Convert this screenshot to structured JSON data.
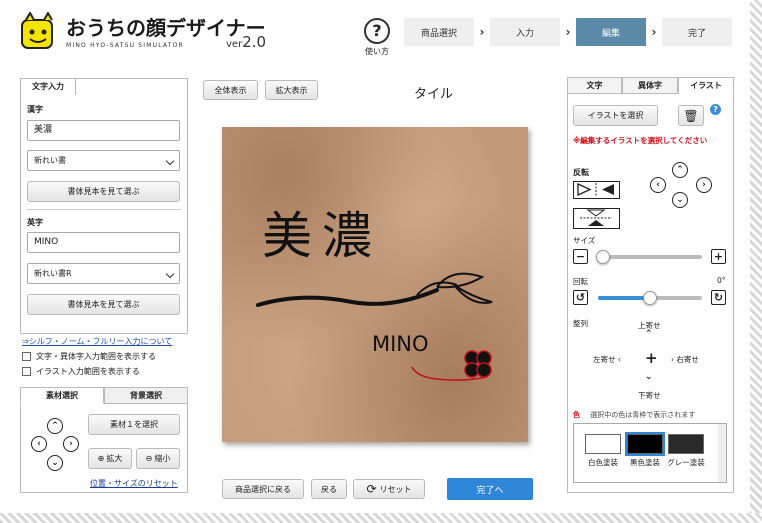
{
  "header": {
    "app_title": "おうちの顔デザイナー",
    "app_subtitle": "MINO HYO-SATSU SIMULATOR",
    "version_prefix": "ver",
    "version_number": "2.0",
    "help_label": "使い方",
    "steps": [
      {
        "label": "商品選択",
        "active": false
      },
      {
        "label": "入力",
        "active": false
      },
      {
        "label": "編集",
        "active": true
      },
      {
        "label": "完了",
        "active": false
      }
    ]
  },
  "text_input_panel": {
    "tab_label": "文字入力",
    "kanji_label": "漢字",
    "kanji_value": "美濃",
    "kanji_font": "新れい書",
    "kanji_sample_button": "書体見本を見て選ぶ",
    "english_label": "英字",
    "english_value": "MINO",
    "english_font": "新れい書R",
    "english_sample_button": "書体見本を見て選ぶ",
    "link_text": "⇒シルフ・ノーム・フルリー入力について",
    "checkbox_text_range": "文字・異体字入力範囲を表示する",
    "checkbox_illust_range": "イラスト入力範囲を表示する"
  },
  "material_panel": {
    "tab_material": "素材選択",
    "tab_background": "背景選択",
    "select_button": "素材１を選択",
    "zoom_in": "拡大",
    "zoom_out": "縮小",
    "reset_link": "位置・サイズのリセット"
  },
  "center": {
    "view_all_button": "全体表示",
    "zoom_view_button": "拡大表示",
    "product_title": "タイル",
    "tile_kanji": "美濃",
    "tile_english": "MINO",
    "back_to_product": "商品選択に戻る",
    "back": "戻る",
    "reset": "リセット",
    "finish": "完了へ"
  },
  "right_panel": {
    "tabs": [
      {
        "label": "文字",
        "active": false
      },
      {
        "label": "異体字",
        "active": false
      },
      {
        "label": "イラスト",
        "active": true
      }
    ],
    "select_illust_button": "イラストを選択",
    "warning": "※編集するイラストを選択してください",
    "flip_label": "反転",
    "size_label": "サイズ",
    "size_value": 0.05,
    "rotate_label": "回転",
    "rotate_value_text": "0°",
    "rotate_value": 0.5,
    "align_label": "整列",
    "align_top": "上寄せ",
    "align_left": "左寄せ",
    "align_right": "右寄せ",
    "align_bottom": "下寄せ",
    "color_label": "色",
    "color_note": "選択中の色は青枠で表示されます",
    "colors": [
      {
        "label": "白色塗装",
        "hex": "#ffffff",
        "selected": false
      },
      {
        "label": "黒色塗装",
        "hex": "#000000",
        "selected": true
      },
      {
        "label": "グレー塗装",
        "hex": "#2a2a2a",
        "selected": false
      }
    ]
  }
}
